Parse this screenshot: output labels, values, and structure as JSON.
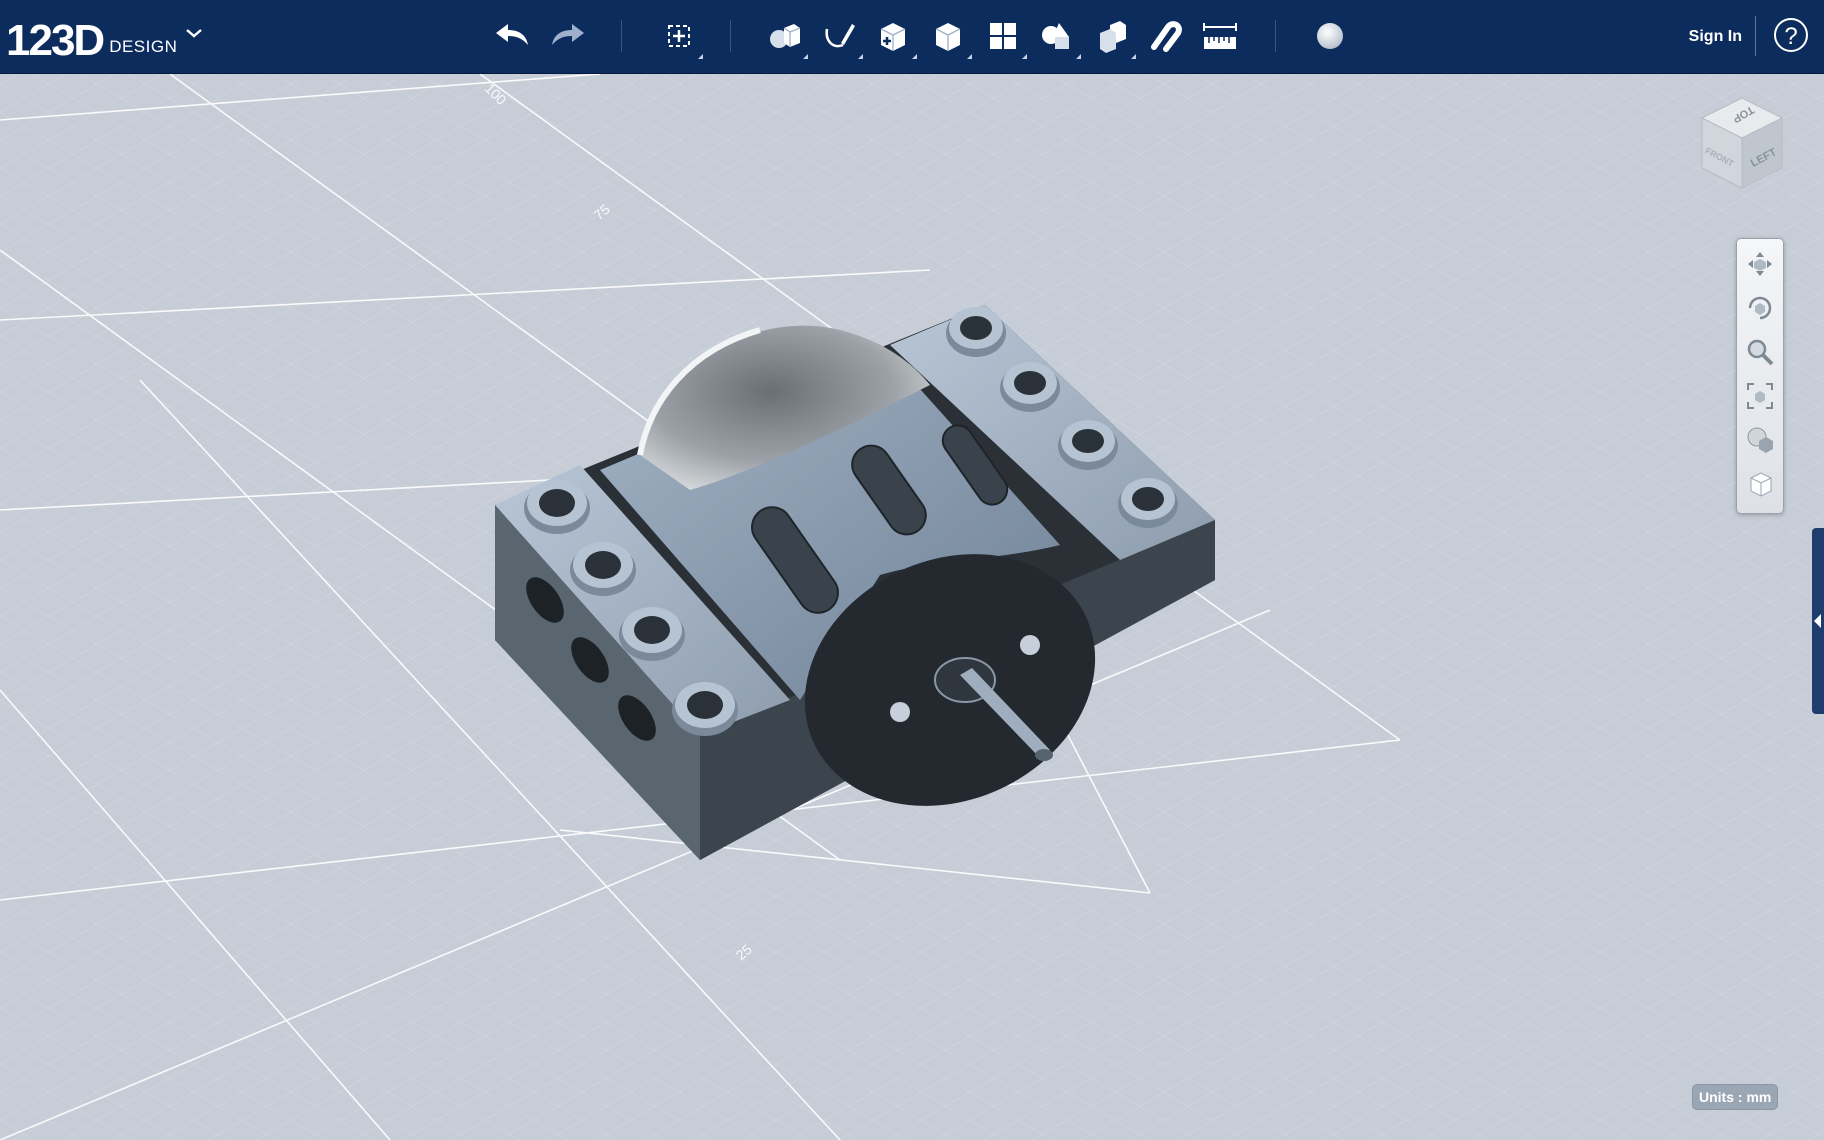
{
  "app": {
    "logo_text": "123D",
    "logo_sub": "DESIGN",
    "logo_caret_icon": "chevron-down-icon"
  },
  "toolbar": {
    "undo_icon": "undo-icon",
    "redo_icon": "redo-icon",
    "transform_icon": "transform-icon",
    "primitives_icon": "primitives-icon",
    "sketch_icon": "sketch-icon",
    "construct_icon": "construct-icon",
    "modify_icon": "modify-icon",
    "pattern_icon": "pattern-icon",
    "grouping_icon": "grouping-icon",
    "combine_icon": "combine-icon",
    "snap_icon": "snap-icon",
    "measure_icon": "measure-icon",
    "material_icon": "material-icon"
  },
  "account": {
    "sign_in_label": "Sign In",
    "help_label": "?"
  },
  "viewcube": {
    "top_label": "TOP",
    "left_label": "LEFT",
    "front_label": "FRONT"
  },
  "grid": {
    "labels": [
      "100",
      "75",
      "25"
    ]
  },
  "navigation": {
    "pan_icon": "pan-icon",
    "orbit_icon": "orbit-icon",
    "zoom_icon": "zoom-icon",
    "fit_icon": "fit-icon",
    "view_mode_icon": "view-mode-icon",
    "material_icon": "solid-view-icon"
  },
  "status": {
    "units_label": "Units : mm"
  },
  "colors": {
    "toolbar_bg": "#0d2c5e",
    "viewport_bg": "#c6cdd6",
    "model_body": "#9aa9bb",
    "model_dark": "#22282e"
  }
}
